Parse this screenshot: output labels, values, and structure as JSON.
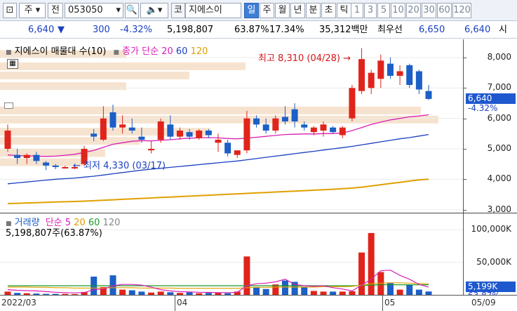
{
  "toolbar": {
    "market": "주",
    "name_btn": "전",
    "code": "053050",
    "search_icon": "search-icon",
    "sound_icon": "speaker-icon",
    "market_tag": "코",
    "stock_name": "지에스이",
    "period_tabs": [
      "일",
      "주",
      "월",
      "년",
      "분",
      "초",
      "틱"
    ],
    "intervals": [
      "1",
      "3",
      "5",
      "10",
      "20",
      "30",
      "60",
      "120"
    ]
  },
  "quote": {
    "price": "6,640",
    "arrow": "▼",
    "change": "300",
    "change_pct": "-4.32%",
    "volume": "5,198,807",
    "vol_ratio": "63.87%",
    "turnover": "17.34%",
    "amount": "35,312백만",
    "best_ask_label": "최우선",
    "best_ask": "6,650",
    "best_bid": "6,640",
    "tail": "시"
  },
  "price_panel": {
    "title": "지에스이 매물대 수(10)",
    "ma_label": "종가 단순",
    "ma_periods": [
      "20",
      "60",
      "120"
    ],
    "ma_colors": [
      "#d81fb5",
      "#1a3fc0",
      "#e0a000"
    ],
    "high_label": "최고 8,310 (04/28)",
    "low_label": "최저 4,330 (03/17)",
    "y_ticks": [
      "8,000",
      "7,000",
      "6,000",
      "5,000",
      "4,000",
      "3,000"
    ],
    "last_price": "6,640",
    "last_pct": "-4.32%"
  },
  "volume_panel": {
    "title": "거래량",
    "ma_label": "단순",
    "ma_periods": [
      "5",
      "20",
      "60",
      "120"
    ],
    "ma_colors": [
      "#d81fb5",
      "#e0a000",
      "#1a9a2a",
      "#888888"
    ],
    "value_text": "5,198,807주(63.87%)",
    "y_ticks": [
      "100,000K",
      "50,000K"
    ],
    "last_vol": "5,199K",
    "last_pct": "63.87%"
  },
  "x_axis": [
    "2022/03",
    "04",
    "05",
    "05/09"
  ],
  "colors": {
    "up": "#e0241b",
    "down": "#1c5fc6",
    "profile": "#f6e3cf"
  },
  "chart_data": {
    "type": "candlestick",
    "y_range": [
      2900,
      8600
    ],
    "candles": [
      {
        "o": 5000,
        "h": 5800,
        "l": 4900,
        "c": 5600
      },
      {
        "o": 4800,
        "h": 5000,
        "l": 4500,
        "c": 4700
      },
      {
        "o": 4700,
        "h": 4850,
        "l": 4500,
        "c": 4800
      },
      {
        "o": 4800,
        "h": 4900,
        "l": 4500,
        "c": 4600
      },
      {
        "o": 4550,
        "h": 4600,
        "l": 4300,
        "c": 4450
      },
      {
        "o": 4450,
        "h": 4500,
        "l": 4330,
        "c": 4400
      },
      {
        "o": 4400,
        "h": 4450,
        "l": 4350,
        "c": 4400
      },
      {
        "o": 4380,
        "h": 4450,
        "l": 4330,
        "c": 4400
      },
      {
        "o": 4500,
        "h": 5100,
        "l": 4450,
        "c": 5000
      },
      {
        "o": 5500,
        "h": 5650,
        "l": 5250,
        "c": 5400
      },
      {
        "o": 5300,
        "h": 6400,
        "l": 5250,
        "c": 6000
      },
      {
        "o": 6200,
        "h": 6450,
        "l": 5600,
        "c": 5700
      },
      {
        "o": 5700,
        "h": 6100,
        "l": 5500,
        "c": 5800
      },
      {
        "o": 5700,
        "h": 6000,
        "l": 5500,
        "c": 5600
      },
      {
        "o": 5400,
        "h": 5700,
        "l": 5200,
        "c": 5300
      },
      {
        "o": 4950,
        "h": 5250,
        "l": 4850,
        "c": 5000
      },
      {
        "o": 5300,
        "h": 6000,
        "l": 5200,
        "c": 5900
      },
      {
        "o": 5800,
        "h": 6100,
        "l": 5300,
        "c": 5400
      },
      {
        "o": 5400,
        "h": 5700,
        "l": 5300,
        "c": 5600
      },
      {
        "o": 5550,
        "h": 5650,
        "l": 5300,
        "c": 5400
      },
      {
        "o": 5350,
        "h": 5650,
        "l": 5300,
        "c": 5600
      },
      {
        "o": 5600,
        "h": 5650,
        "l": 5350,
        "c": 5450
      },
      {
        "o": 5200,
        "h": 5500,
        "l": 4900,
        "c": 5300
      },
      {
        "o": 5200,
        "h": 5300,
        "l": 4750,
        "c": 4850
      },
      {
        "o": 4800,
        "h": 4950,
        "l": 4700,
        "c": 4950
      },
      {
        "o": 4950,
        "h": 6250,
        "l": 4850,
        "c": 6000
      },
      {
        "o": 6000,
        "h": 6100,
        "l": 5700,
        "c": 5800
      },
      {
        "o": 5800,
        "h": 6000,
        "l": 5500,
        "c": 5600
      },
      {
        "o": 5600,
        "h": 6100,
        "l": 5500,
        "c": 6000
      },
      {
        "o": 6050,
        "h": 6400,
        "l": 5800,
        "c": 5900
      },
      {
        "o": 6300,
        "h": 6500,
        "l": 5700,
        "c": 5900
      },
      {
        "o": 5800,
        "h": 5900,
        "l": 5600,
        "c": 5700
      },
      {
        "o": 5550,
        "h": 5750,
        "l": 5450,
        "c": 5700
      },
      {
        "o": 5600,
        "h": 5900,
        "l": 5400,
        "c": 5800
      },
      {
        "o": 5700,
        "h": 5750,
        "l": 5500,
        "c": 5550
      },
      {
        "o": 5450,
        "h": 5750,
        "l": 5350,
        "c": 5700
      },
      {
        "o": 6000,
        "h": 7100,
        "l": 5900,
        "c": 7000
      },
      {
        "o": 6900,
        "h": 8310,
        "l": 6800,
        "c": 7950
      },
      {
        "o": 7000,
        "h": 7600,
        "l": 6800,
        "c": 7500
      },
      {
        "o": 7300,
        "h": 8100,
        "l": 7000,
        "c": 7900
      },
      {
        "o": 7800,
        "h": 8000,
        "l": 7300,
        "c": 7400
      },
      {
        "o": 7400,
        "h": 7750,
        "l": 7100,
        "c": 7550
      },
      {
        "o": 7750,
        "h": 7800,
        "l": 7000,
        "c": 7100
      },
      {
        "o": 7550,
        "h": 7600,
        "l": 6800,
        "c": 6950
      },
      {
        "o": 6900,
        "h": 7100,
        "l": 6600,
        "c": 6640
      }
    ],
    "ma20": [
      4800,
      4780,
      4770,
      4760,
      4750,
      4760,
      4790,
      4820,
      4880,
      4950,
      5050,
      5150,
      5200,
      5250,
      5270,
      5260,
      5280,
      5300,
      5330,
      5350,
      5360,
      5370,
      5360,
      5340,
      5330,
      5350,
      5380,
      5410,
      5440,
      5470,
      5480,
      5490,
      5490,
      5500,
      5500,
      5520,
      5600,
      5700,
      5800,
      5880,
      5950,
      6000,
      6050,
      6080,
      6120
    ],
    "ma60": [
      3850,
      3880,
      3910,
      3940,
      3970,
      4000,
      4020,
      4040,
      4070,
      4100,
      4140,
      4180,
      4220,
      4260,
      4300,
      4330,
      4360,
      4390,
      4420,
      4450,
      4480,
      4510,
      4540,
      4570,
      4600,
      4640,
      4680,
      4720,
      4760,
      4800,
      4840,
      4880,
      4920,
      4960,
      5000,
      5040,
      5080,
      5130,
      5180,
      5230,
      5280,
      5330,
      5370,
      5420,
      5470
    ],
    "ma120": [
      3200,
      3210,
      3220,
      3230,
      3240,
      3250,
      3260,
      3270,
      3280,
      3295,
      3310,
      3325,
      3340,
      3355,
      3370,
      3385,
      3400,
      3415,
      3430,
      3445,
      3460,
      3475,
      3490,
      3505,
      3520,
      3535,
      3550,
      3565,
      3580,
      3595,
      3610,
      3625,
      3640,
      3655,
      3670,
      3690,
      3710,
      3740,
      3780,
      3820,
      3860,
      3900,
      3940,
      3980,
      4000
    ],
    "volume": [
      5000,
      3000,
      2500,
      2000,
      1500,
      1500,
      1500,
      1200,
      4500,
      28000,
      12000,
      30000,
      8000,
      7000,
      5000,
      3500,
      5000,
      4000,
      3000,
      4000,
      2500,
      3000,
      3500,
      2500,
      5000,
      59000,
      12000,
      9000,
      16000,
      22000,
      20000,
      12000,
      6000,
      5000,
      5000,
      5000,
      5500,
      65000,
      95000,
      35000,
      18000,
      8000,
      16000,
      8000,
      5199
    ],
    "vol_ma5": [
      8000,
      7000,
      6500,
      6000,
      5000,
      4000,
      3500,
      3000,
      3500,
      8000,
      9000,
      14000,
      16000,
      16000,
      15000,
      12000,
      8000,
      6000,
      5000,
      4500,
      4000,
      3800,
      3500,
      3500,
      4000,
      14000,
      17000,
      18000,
      20000,
      24000,
      16000,
      14000,
      13000,
      14000,
      11000,
      9000,
      6000,
      15000,
      24000,
      37000,
      38000,
      30000,
      24000,
      16000,
      12000
    ],
    "vol_ma20": [
      12000,
      12000,
      12000,
      11500,
      11500,
      11000,
      11000,
      10500,
      10500,
      10500,
      10500,
      11000,
      11000,
      11000,
      10500,
      10500,
      10500,
      10500,
      10000,
      10000,
      10000,
      10000,
      10000,
      10000,
      10000,
      11000,
      11500,
      11500,
      12000,
      12000,
      12000,
      12000,
      12000,
      12500,
      12500,
      12500,
      13000,
      15000,
      17000,
      18000,
      18500,
      18500,
      18000,
      17500,
      17000
    ],
    "vol_ma60": [
      14000,
      14000,
      14000,
      14000,
      14000,
      14000,
      14000,
      14000,
      14000,
      14000,
      14000,
      14000,
      14000,
      14000,
      14000,
      14000,
      14000,
      14000,
      14000,
      14000,
      14000,
      14000,
      14000,
      14000,
      14000,
      14000,
      14000,
      14000,
      14000,
      14000,
      14000,
      14000,
      14000,
      14000,
      14000,
      14000,
      14000,
      14500,
      15000,
      15500,
      15500,
      15500,
      15500,
      15500,
      15500
    ],
    "vol_range": [
      0,
      110000
    ]
  }
}
